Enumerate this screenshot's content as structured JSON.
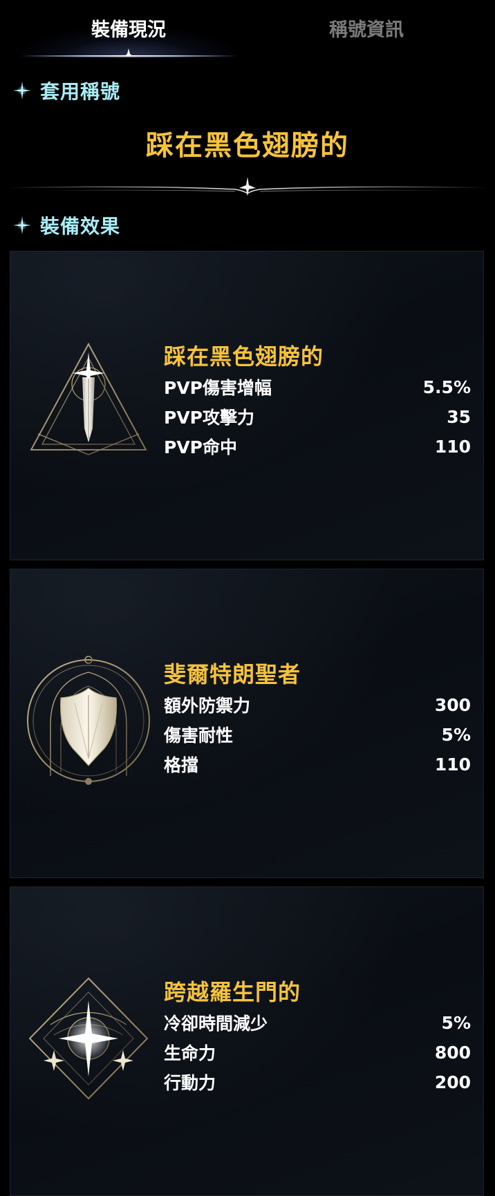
{
  "tabs": [
    {
      "label": "裝備現況",
      "active": true
    },
    {
      "label": "稱號資訊",
      "active": false
    }
  ],
  "applied": {
    "header": "套用稱號",
    "title": "踩在黑色翅膀的"
  },
  "effects": {
    "header": "裝備效果",
    "cards": [
      {
        "name": "踩在黑色翅膀的",
        "icon": "sword-triangle-emblem-icon",
        "stats": [
          {
            "label": "PVP傷害增幅",
            "value": "5.5%"
          },
          {
            "label": "PVP攻擊力",
            "value": "35"
          },
          {
            "label": "PVP命中",
            "value": "110"
          }
        ]
      },
      {
        "name": "斐爾特朗聖者",
        "icon": "shield-circle-emblem-icon",
        "stats": [
          {
            "label": "額外防禦力",
            "value": "300"
          },
          {
            "label": "傷害耐性",
            "value": "5%"
          },
          {
            "label": "格擋",
            "value": "110"
          }
        ]
      },
      {
        "name": "跨越羅生門的",
        "icon": "star-diamond-emblem-icon",
        "stats": [
          {
            "label": "冷卻時間減少",
            "value": "5%"
          },
          {
            "label": "生命力",
            "value": "800"
          },
          {
            "label": "行動力",
            "value": "200"
          }
        ]
      }
    ]
  },
  "colors": {
    "background": "#000000",
    "accent_gold": "#f6c33b",
    "section_cyan": "#a9ecf6",
    "tab_inactive": "#7b7b7b"
  }
}
